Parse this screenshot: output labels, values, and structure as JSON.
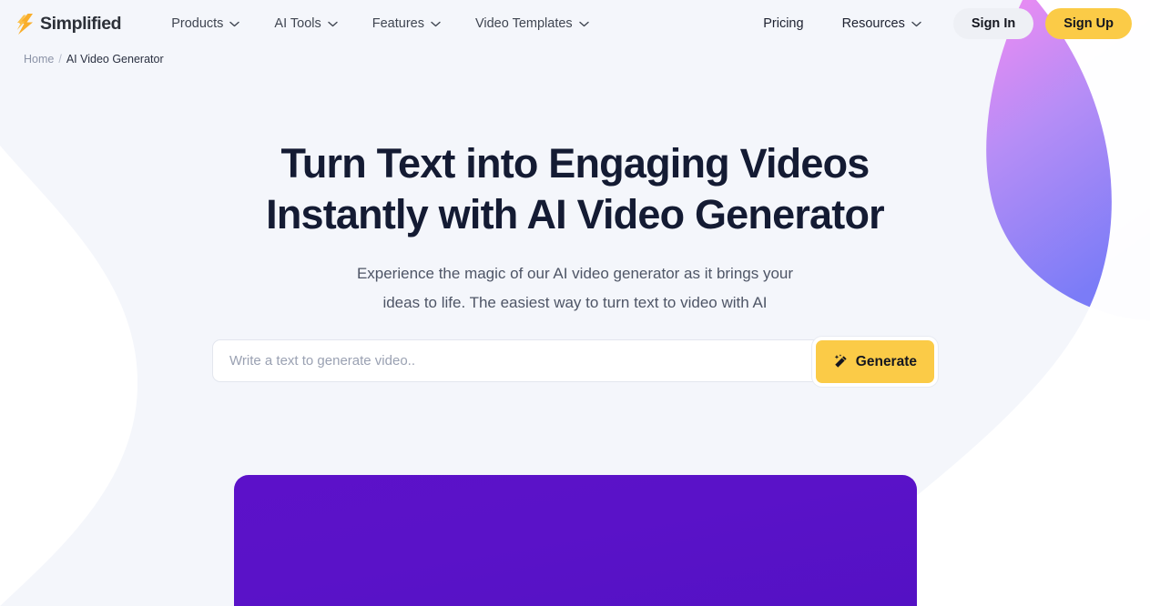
{
  "brand": {
    "name": "Simplified",
    "logo_icon": "simplified-bolt-logo",
    "logo_color": "#f9ae2b"
  },
  "nav": {
    "items": [
      {
        "label": "Products",
        "has_dropdown": true,
        "icon": "chevron-down-icon"
      },
      {
        "label": "AI Tools",
        "has_dropdown": true,
        "icon": "chevron-down-icon"
      },
      {
        "label": "Features",
        "has_dropdown": true,
        "icon": "chevron-down-icon"
      },
      {
        "label": "Video Templates",
        "has_dropdown": true,
        "icon": "chevron-down-icon"
      }
    ],
    "right_items": [
      {
        "label": "Pricing",
        "has_dropdown": false
      },
      {
        "label": "Resources",
        "has_dropdown": true,
        "icon": "chevron-down-icon"
      }
    ],
    "sign_in": "Sign In",
    "sign_up": "Sign Up",
    "sign_up_color": "#fbcb47",
    "sign_in_bg": "#eef0f5"
  },
  "breadcrumb": {
    "home": "Home",
    "separator": "/",
    "current": "AI Video Generator"
  },
  "hero": {
    "title_line1": "Turn Text into Engaging Videos",
    "title_line2": "Instantly with AI Video Generator",
    "subtitle_line1": "Experience the magic of our AI video generator as it brings your",
    "subtitle_line2": "ideas to life. The easiest way to turn text to video with AI"
  },
  "generator": {
    "placeholder": "Write a text to generate video..",
    "value": "",
    "button_label": "Generate",
    "button_icon": "magic-wand-icon",
    "button_color": "#fbcb47"
  },
  "video_preview": {
    "label": "",
    "background_color": "#5a12c8"
  },
  "decor": {
    "blob_right_from": "#e98cf3",
    "blob_right_to": "#7d7bf5",
    "blob_left_from": "#f9cf3f",
    "blob_left_to": "#74c6c8",
    "page_background": "#f4f6fb"
  }
}
